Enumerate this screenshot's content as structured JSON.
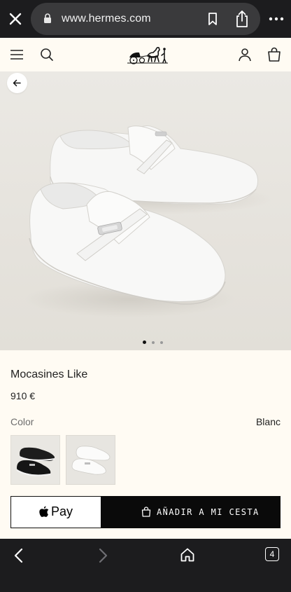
{
  "browser": {
    "url": "www.hermes.com",
    "tab_count": "4"
  },
  "icons": {
    "close": "close-icon",
    "lock": "lock-icon",
    "bookmark": "bookmark-icon",
    "share": "share-icon",
    "more": "more-icon",
    "menu": "menu-icon",
    "search": "search-icon",
    "logo": "hermes-carriage-logo",
    "account": "account-icon",
    "bag": "shopping-bag-icon",
    "back": "arrow-left-icon",
    "apple": "apple-logo-icon",
    "nav_back": "chevron-left-icon",
    "nav_forward": "chevron-right-icon",
    "home": "home-icon"
  },
  "carousel": {
    "slide_count": 3,
    "active_slide": 1
  },
  "product": {
    "name": "Mocasines Like",
    "price": "910 €",
    "color_label": "Color",
    "color_value": "Blanc",
    "swatches": [
      "black",
      "white"
    ]
  },
  "actions": {
    "apple_pay_label": "Pay",
    "add_to_cart_label": "AÑADIR A MI CESTA"
  },
  "colors": {
    "browser_chrome": "#1c1c1e",
    "page_background": "#fffbf3",
    "button_black": "#0a0a0a"
  }
}
